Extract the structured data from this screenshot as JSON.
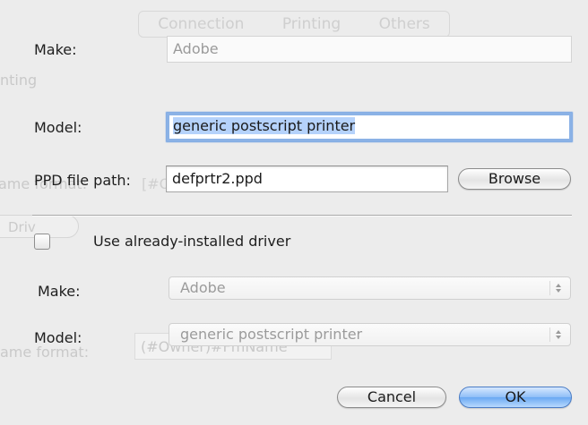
{
  "background": {
    "tabs": [
      "Connection",
      "Printing",
      "Others"
    ],
    "side_text_1": "nting",
    "side_text_2": "ame format:",
    "side_text_3": "ame format:",
    "pill_text": "Driv",
    "field_text": "(#Owner)#FmName",
    "field_text_2": "[#O"
  },
  "form": {
    "make_label": "Make:",
    "make_value": "Adobe",
    "model_label": "Model:",
    "model_value": "generic postscript printer",
    "ppd_label": "PPD file path:",
    "ppd_value": "defprtr2.ppd",
    "browse_label": "Browse"
  },
  "driver": {
    "checkbox_label": "Use already-installed driver",
    "checked": false,
    "make_label": "Make:",
    "make_value": "Adobe",
    "model_label": "Model:",
    "model_value": "generic postscript printer"
  },
  "actions": {
    "cancel_label": "Cancel",
    "ok_label": "OK"
  },
  "colors": {
    "dialog_bg": "#ececec",
    "focus_ring": "#8bb2e6",
    "selection": "#b5d2fb",
    "default_button": "#6aa8f3"
  }
}
